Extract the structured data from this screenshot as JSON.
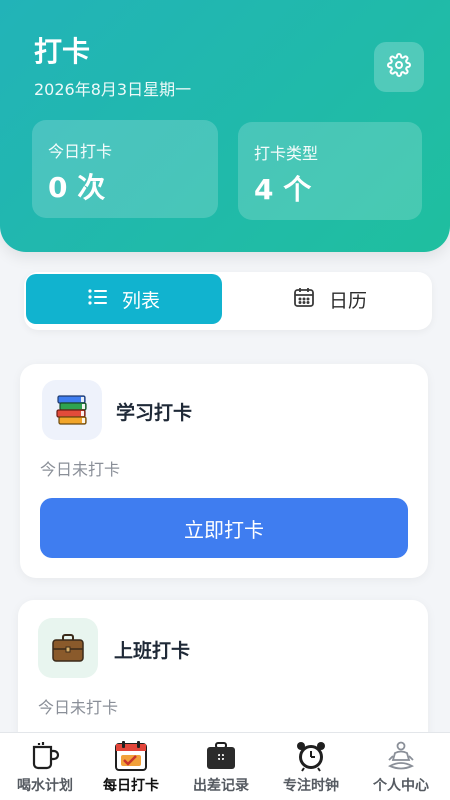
{
  "header": {
    "title": "打卡",
    "date": "2026年8月3日星期一",
    "stats": [
      {
        "label": "今日打卡",
        "value": "0 次"
      },
      {
        "label": "打卡类型",
        "value": "4 个"
      }
    ]
  },
  "view_switch": {
    "options": [
      {
        "label": "列表",
        "icon": "list-icon",
        "active": true
      },
      {
        "label": "日历",
        "icon": "calendar-icon",
        "active": false
      }
    ]
  },
  "habits": [
    {
      "name": "学习打卡",
      "icon": "books-icon",
      "status": "今日未打卡",
      "button": "立即打卡"
    },
    {
      "name": "上班打卡",
      "icon": "briefcase-icon",
      "status": "今日未打卡"
    }
  ],
  "tabbar": {
    "items": [
      {
        "label": "喝水计划",
        "icon": "cup-icon"
      },
      {
        "label": "每日打卡",
        "icon": "calendar-check-icon",
        "active": true
      },
      {
        "label": "出差记录",
        "icon": "travel-bag-icon"
      },
      {
        "label": "专注时钟",
        "icon": "alarm-clock-icon"
      },
      {
        "label": "个人中心",
        "icon": "meditation-icon"
      }
    ]
  },
  "colors": {
    "header_gradient_start": "#22b3b8",
    "header_gradient_end": "#1fbf9f",
    "segment_active": "#11b3cf",
    "primary_button": "#3f7df0"
  }
}
